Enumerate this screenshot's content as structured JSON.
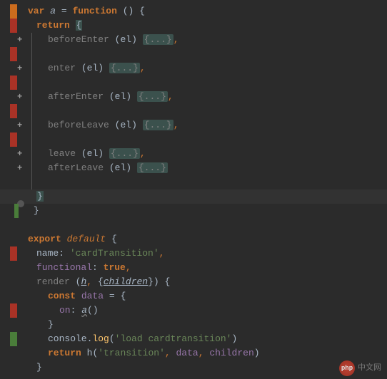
{
  "gutter": {
    "plus": "+"
  },
  "code": {
    "line1": {
      "var": "var",
      "a": "a",
      "eq": "=",
      "function": "function",
      "parens": "()",
      "brace": "{"
    },
    "line2": {
      "return": "return",
      "brace": "{"
    },
    "line3": {
      "fn": "beforeEnter",
      "lp": "(",
      "el": "el",
      "rp": ")",
      "body": "{...}",
      "comma": ","
    },
    "line4": {
      "fn": "enter",
      "lp": "(",
      "el": "el",
      "rp": ")",
      "body": "{...}",
      "comma": ","
    },
    "line5": {
      "fn": "afterEnter",
      "lp": "(",
      "el": "el",
      "rp": ")",
      "body": "{...}",
      "comma": ","
    },
    "line6": {
      "fn": "beforeLeave",
      "lp": "(",
      "el": "el",
      "rp": ")",
      "body": "{...}",
      "comma": ","
    },
    "line7": {
      "fn": "leave",
      "lp": "(",
      "el": "el",
      "rp": ")",
      "body": "{...}",
      "comma": ","
    },
    "line8": {
      "fn": "afterLeave",
      "lp": "(",
      "el": "el",
      "rp": ")",
      "body": "{...}"
    },
    "line9": {
      "brace": "}"
    },
    "line10": {
      "brace": "}"
    },
    "line12": {
      "export": "export",
      "default": "default",
      "brace": "{"
    },
    "line13": {
      "name": "name",
      "colon": ":",
      "val": "'cardTransition'",
      "comma": ","
    },
    "line14": {
      "functional": "functional",
      "colon": ":",
      "true": "true",
      "comma": ","
    },
    "line15": {
      "render": "render",
      "lp": "(",
      "h": "h",
      "comma1": ",",
      "lb": "{",
      "children": "children",
      "rb": "}",
      "rp": ")",
      "brace": "{"
    },
    "line16": {
      "const": "const",
      "data": "data",
      "eq": "=",
      "brace": "{"
    },
    "line17": {
      "on": "on",
      "colon": ":",
      "a": "a",
      "parens": "()"
    },
    "line18": {
      "brace": "}"
    },
    "line19": {
      "console": "console",
      "dot": ".",
      "log": "log",
      "lp": "(",
      "str": "'load cardtransition'",
      "rp": ")"
    },
    "line20": {
      "return": "return",
      "h": "h",
      "lp": "(",
      "str": "'transition'",
      "comma1": ",",
      "data": "data",
      "comma2": ",",
      "children": "children",
      "rp": ")"
    },
    "line21": {
      "brace": "}"
    }
  },
  "watermark": {
    "logo": "php",
    "text": "中文网"
  }
}
